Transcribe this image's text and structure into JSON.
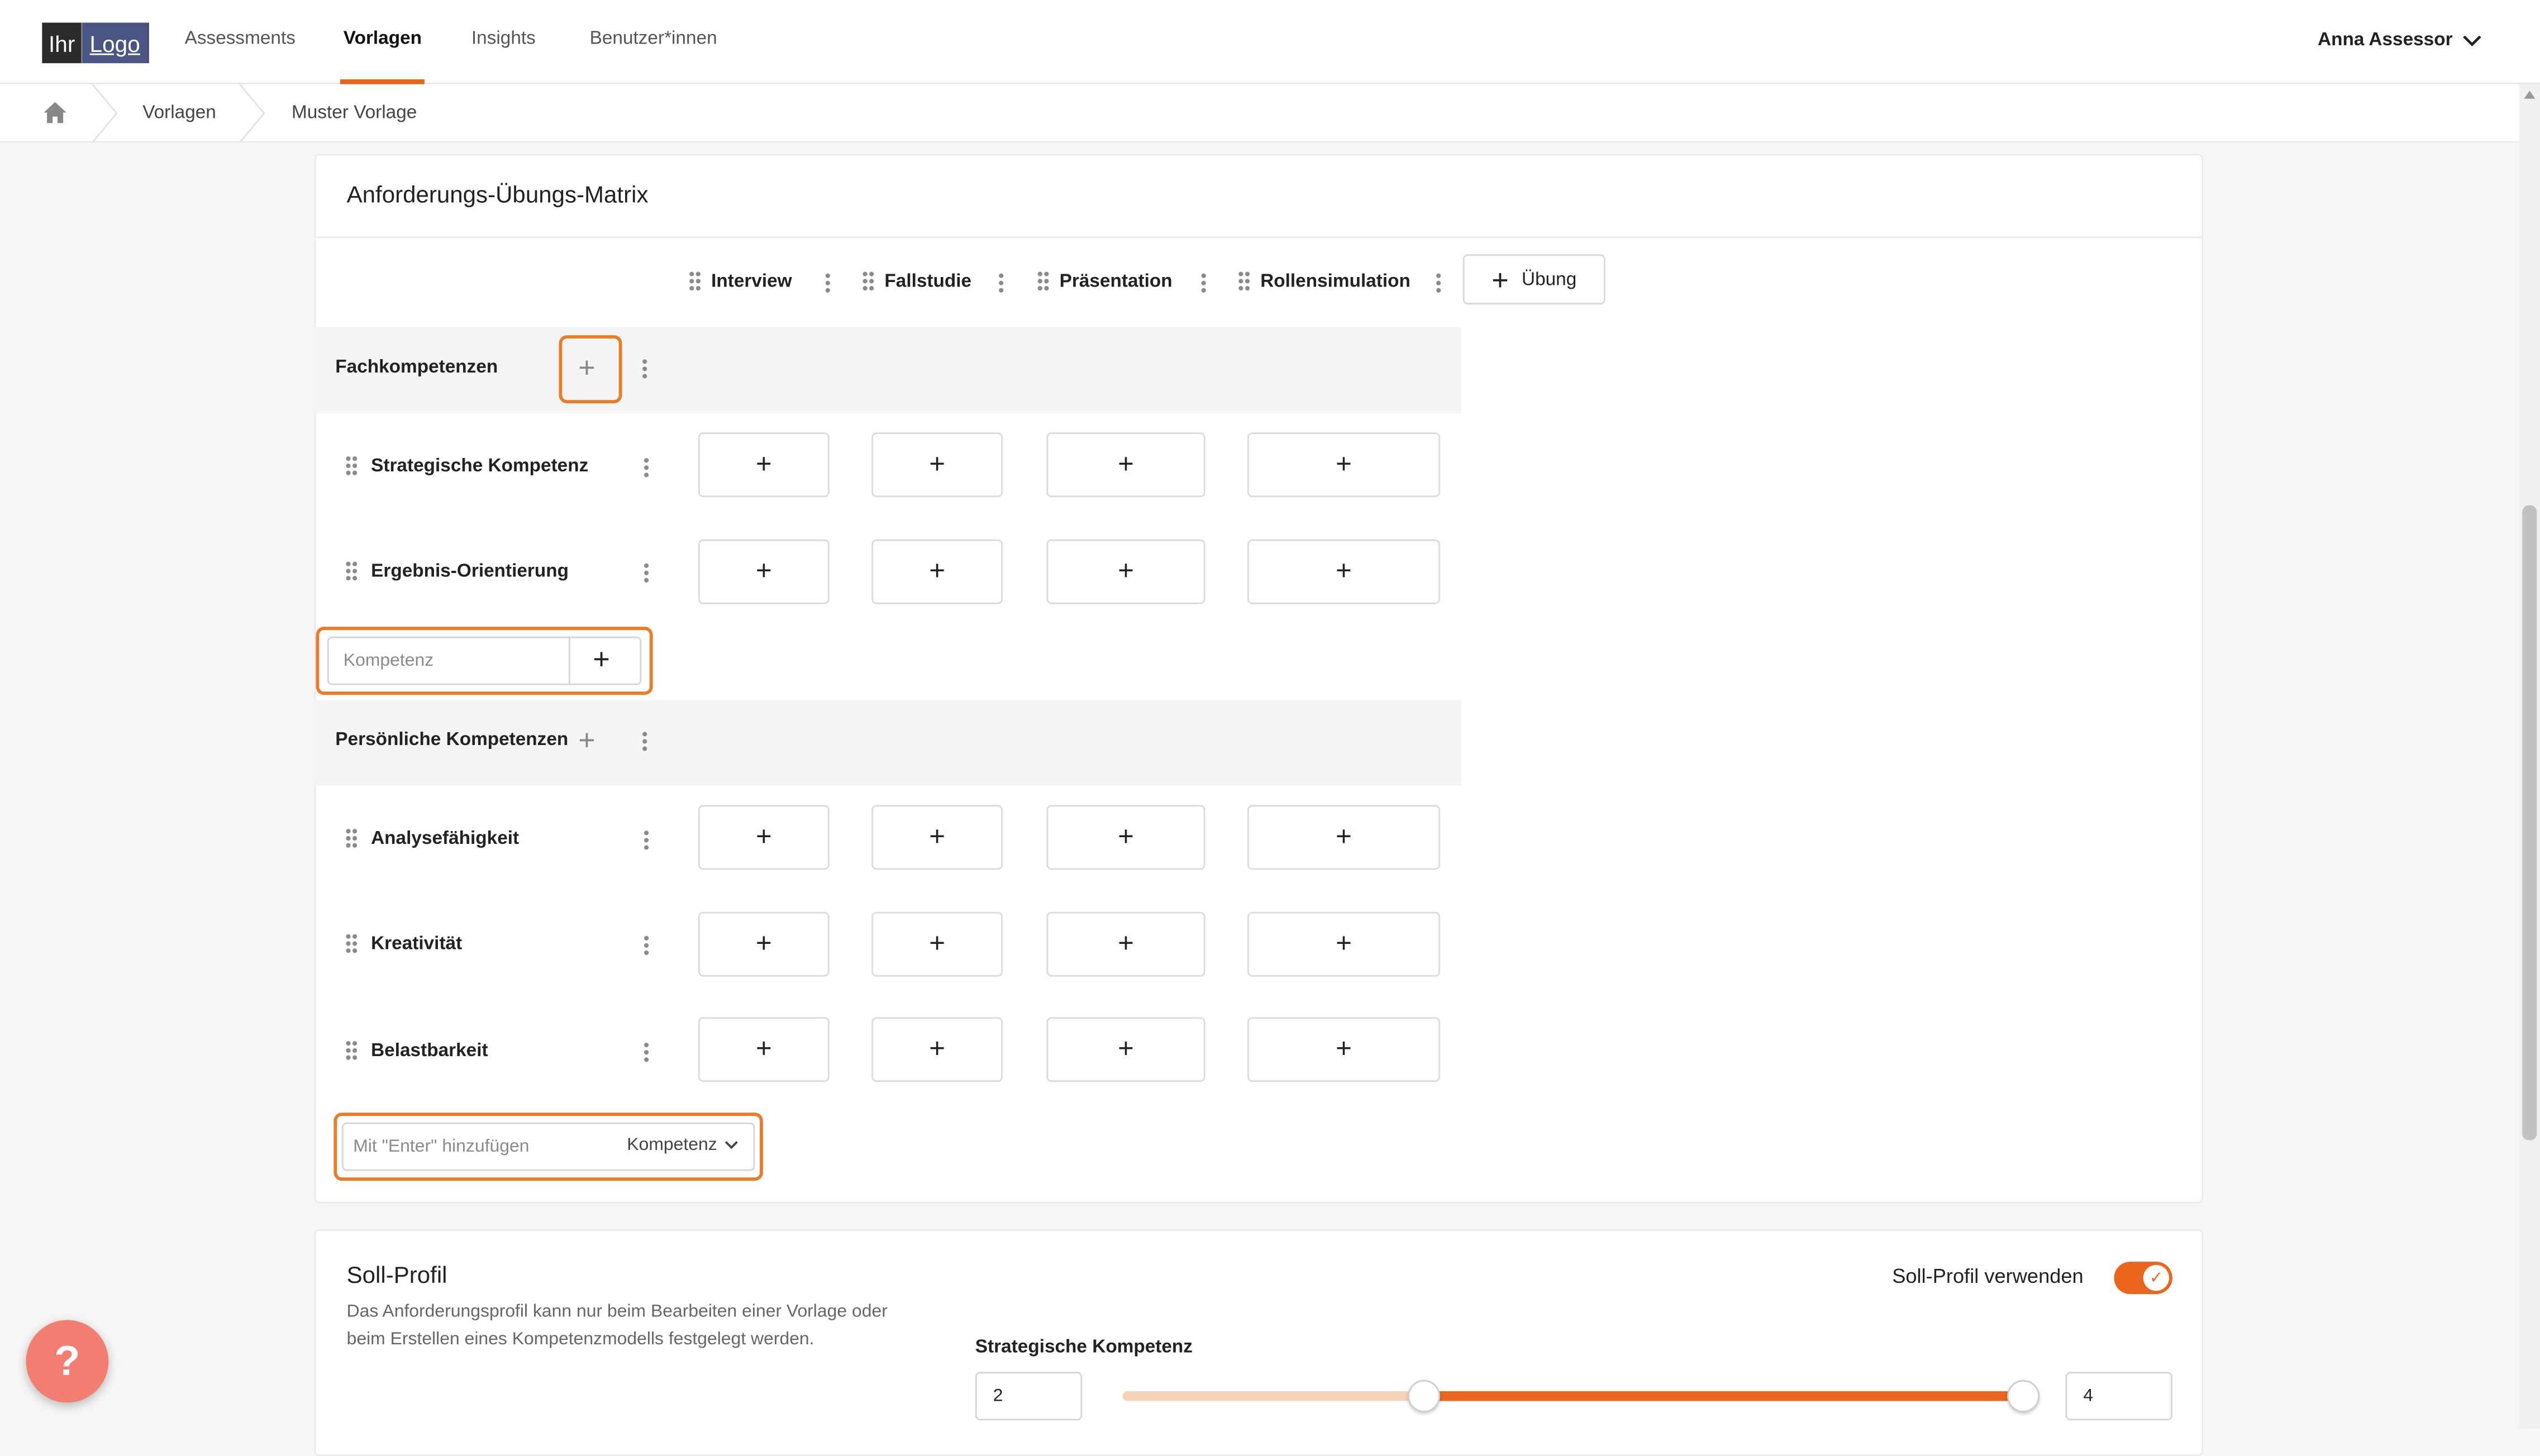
{
  "brand": {
    "logo_part1": "Ihr",
    "logo_part2": "Logo"
  },
  "nav": {
    "items": [
      {
        "label": "Assessments"
      },
      {
        "label": "Vorlagen"
      },
      {
        "label": "Insights"
      },
      {
        "label": "Benutzer*innen"
      }
    ],
    "active": "Vorlagen",
    "user": "Anna Assessor"
  },
  "breadcrumb": {
    "items": [
      "Vorlagen",
      "Muster Vorlage"
    ]
  },
  "matrix": {
    "title": "Anforderungs-Übungs-Matrix",
    "exercises": [
      "Interview",
      "Fallstudie",
      "Präsentation",
      "Rollensimulation"
    ],
    "add_exercise_label": "Übung",
    "groups": [
      {
        "name": "Fachkompetenzen",
        "rows": [
          "Strategische Kompetenz",
          "Ergebnis-Orientierung"
        ],
        "add_placeholder": "Kompetenz"
      },
      {
        "name": "Persönliche Kompetenzen",
        "rows": [
          "Analysefähigkeit",
          "Kreativität",
          "Belastbarkeit"
        ]
      }
    ],
    "bottom_input": {
      "placeholder": "Mit \"Enter\" hinzufügen",
      "type_select": "Kompetenz"
    }
  },
  "soll_profil": {
    "title": "Soll-Profil",
    "description_line1": "Das Anforderungsprofil kann nur beim Bearbeiten einer Vorlage oder",
    "description_line2": "beim Erstellen eines Kompetenzmodells festgelegt werden.",
    "toggle_label": "Soll-Profil verwenden",
    "toggle_on": true,
    "competency": "Strategische Kompetenz",
    "min_value": "2",
    "max_value": "4"
  },
  "help": {
    "label": "?"
  },
  "colors": {
    "accent": "#e9661c",
    "highlight": "#ea7b29",
    "help": "#f27d71"
  }
}
